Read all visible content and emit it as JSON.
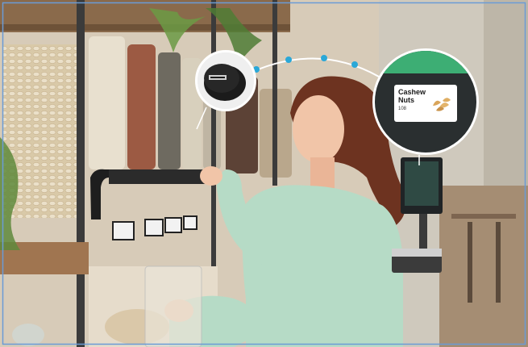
{
  "zoom_label": {
    "product_name": "Cashew Nuts",
    "product_code": "108"
  },
  "icons": [
    "tag-sensor-icon",
    "cashew-nuts-image"
  ]
}
